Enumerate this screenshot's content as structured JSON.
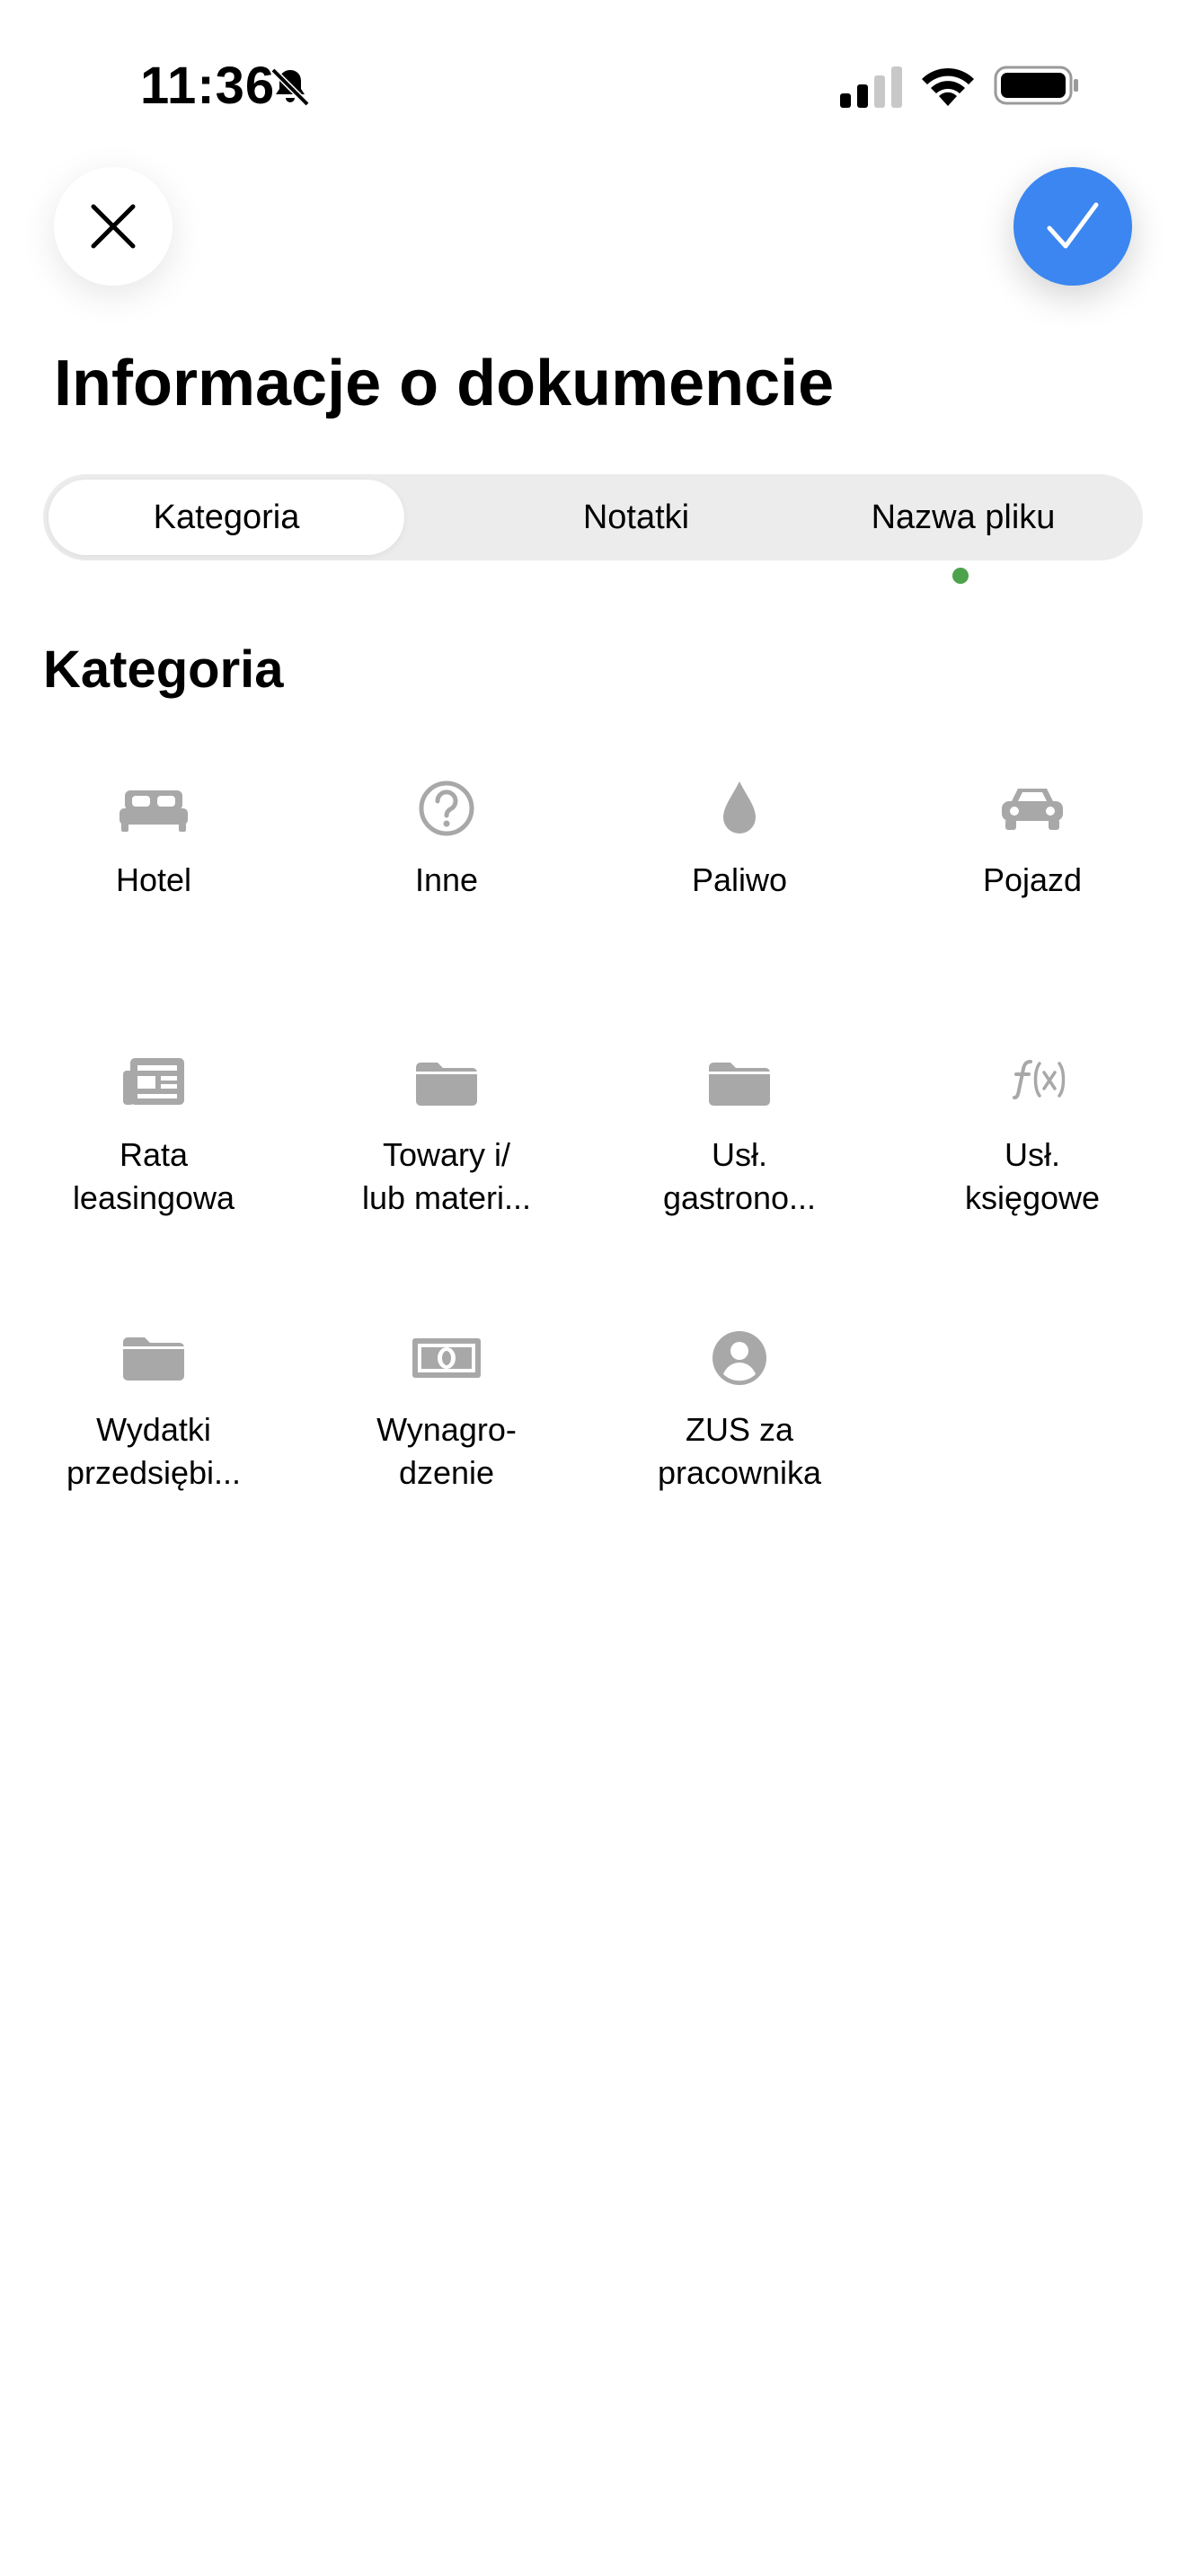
{
  "status_bar": {
    "time": "11:36"
  },
  "header": {
    "title": "Informacje o dokumencie"
  },
  "tabs": [
    {
      "label": "Kategoria"
    },
    {
      "label": "Notatki"
    },
    {
      "label": "Nazwa pliku"
    }
  ],
  "section": {
    "title": "Kategoria"
  },
  "categories": [
    {
      "line1": "Hotel",
      "line2": "",
      "icon": "bed-icon"
    },
    {
      "line1": "Inne",
      "line2": "",
      "icon": "question-icon"
    },
    {
      "line1": "Paliwo",
      "line2": "",
      "icon": "fuel-drop-icon"
    },
    {
      "line1": "Pojazd",
      "line2": "",
      "icon": "car-icon"
    },
    {
      "line1": "Rata",
      "line2": "leasingowa",
      "icon": "newspaper-icon"
    },
    {
      "line1": "Towary i/",
      "line2": "lub materi...",
      "icon": "folder-icon"
    },
    {
      "line1": "Usł.",
      "line2": "gastrono...",
      "icon": "folder-icon"
    },
    {
      "line1": "Usł.",
      "line2": "księgowe",
      "icon": "function-icon"
    },
    {
      "line1": "Wydatki",
      "line2": "przedsiębi...",
      "icon": "folder-icon"
    },
    {
      "line1": "Wynagro-",
      "line2": "dzenie",
      "icon": "money-icon"
    },
    {
      "line1": "ZUS za",
      "line2": "pracownika",
      "icon": "person-icon"
    }
  ],
  "colors": {
    "accent": "#3b86f0",
    "icon": "#a8a8a8",
    "indicator": "#4ca34c",
    "tab_bg": "#ececec"
  }
}
